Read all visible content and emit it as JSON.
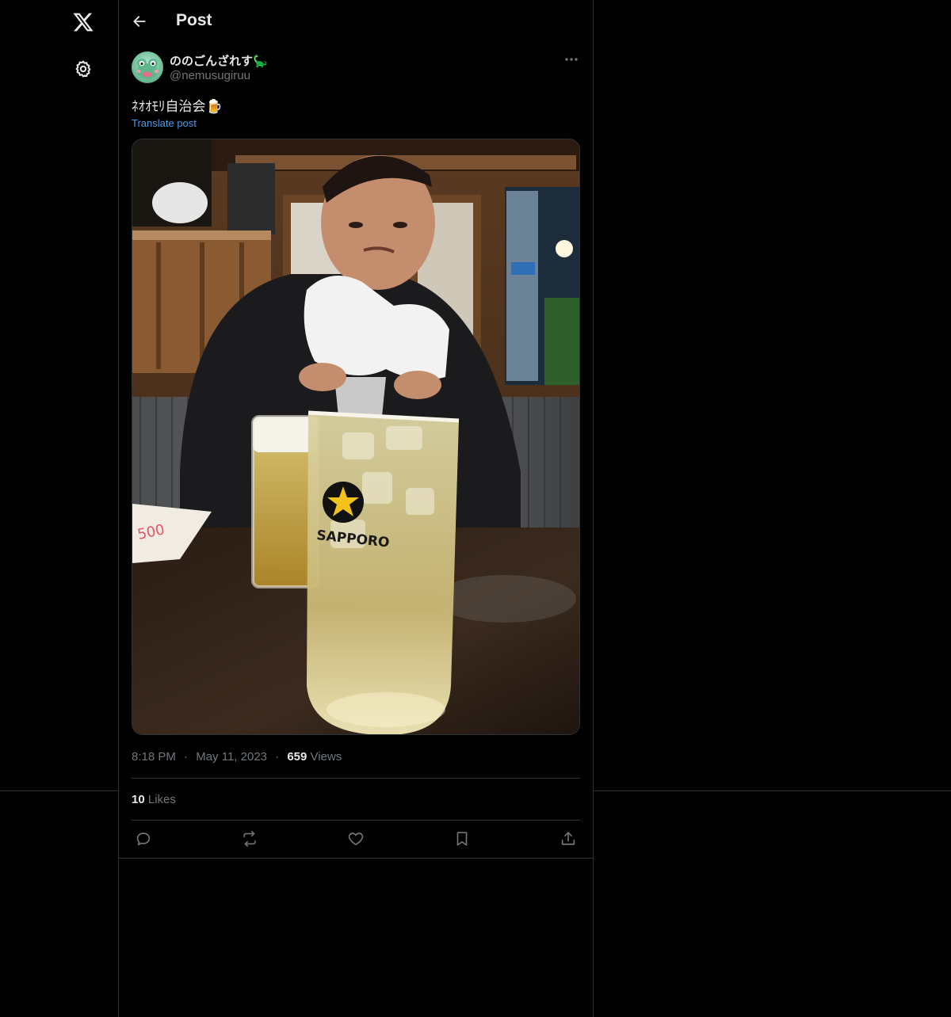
{
  "nav": {
    "logo_icon": "x-logo-icon",
    "settings_icon": "gear-icon"
  },
  "header": {
    "back_icon": "arrow-left-icon",
    "title": "Post"
  },
  "post": {
    "author": {
      "display_name": "ののごんざれす🦕",
      "handle": "@nemusugiruu"
    },
    "more_icon": "more-horizontal-icon",
    "text": "ﾈｵｵﾓﾘ自治会🍺",
    "translate_label": "Translate post",
    "media": {
      "brand_label": "SAPPORO"
    },
    "time": "8:18 PM",
    "separator": "·",
    "date": "May 11, 2023",
    "views_count": "659",
    "views_label": "Views",
    "likes_count": "10",
    "likes_label": "Likes"
  },
  "actions": {
    "reply_icon": "reply-icon",
    "repost_icon": "repost-icon",
    "like_icon": "heart-icon",
    "bookmark_icon": "bookmark-icon",
    "share_icon": "share-icon"
  },
  "colors": {
    "background": "#000000",
    "border": "#2f3336",
    "text_primary": "#e7e9ea",
    "text_secondary": "#71767b",
    "link": "#4c9be8"
  }
}
